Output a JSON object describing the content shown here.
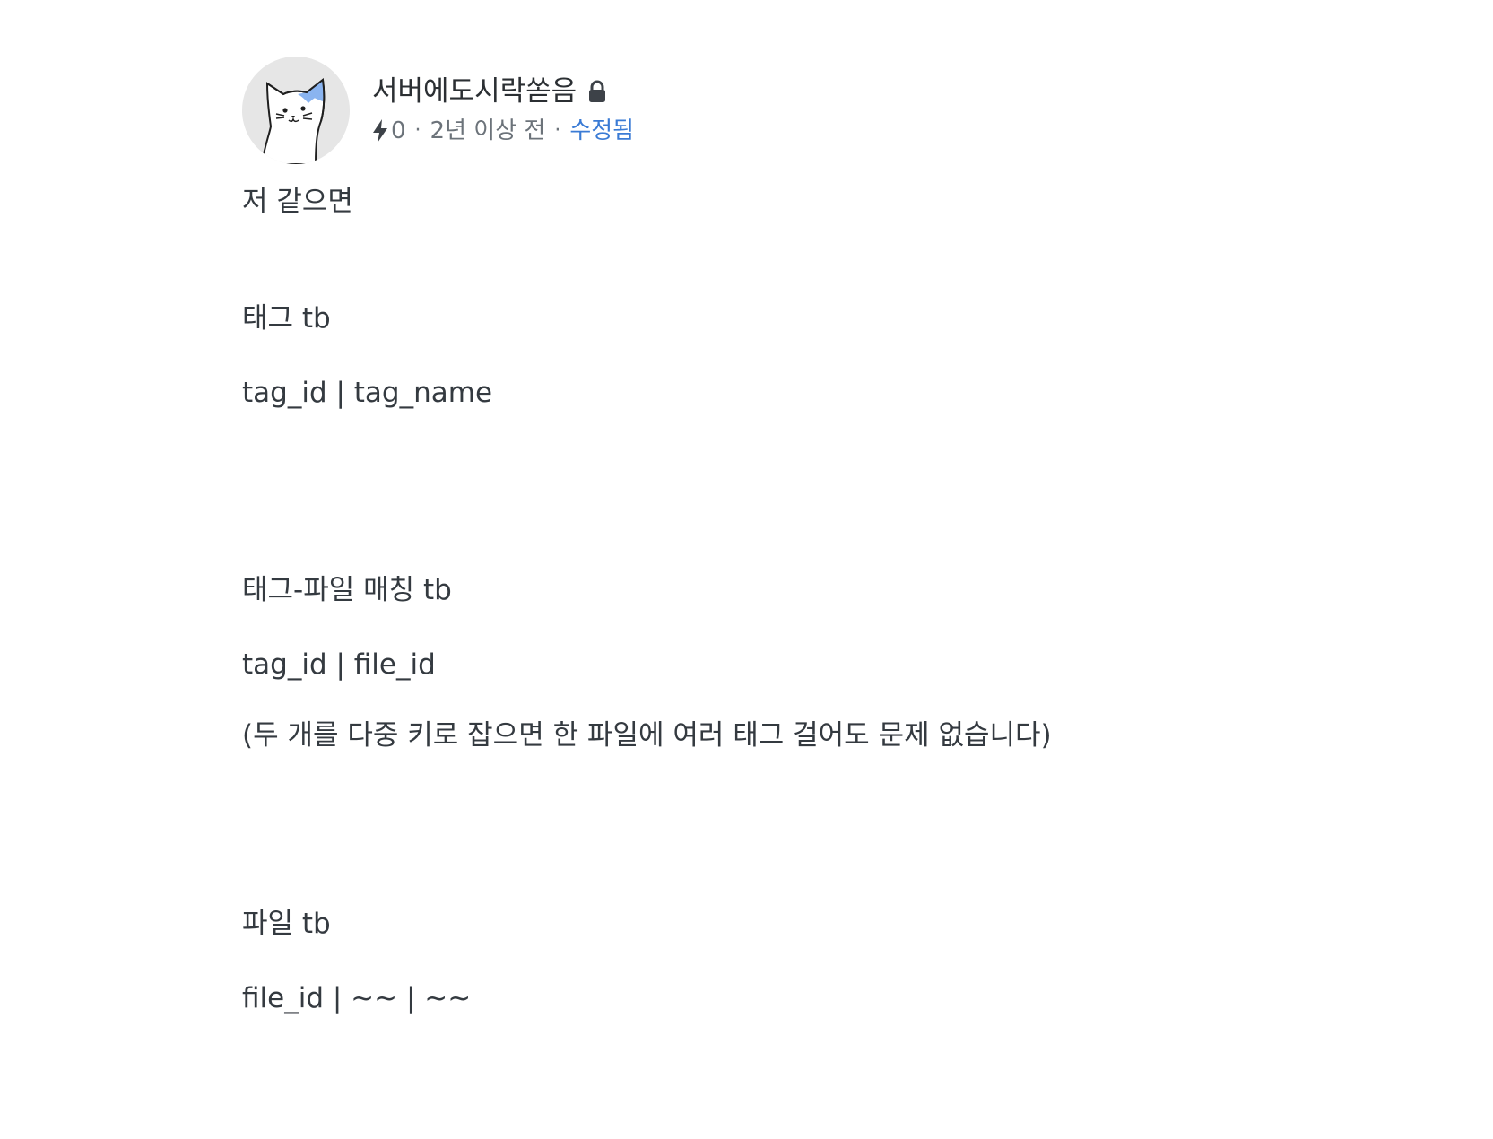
{
  "author": {
    "name": "서버에도시락쏟음",
    "avatar_icon": "cat-avatar-icon",
    "lock_icon": "lock-icon"
  },
  "meta": {
    "vote_icon": "bolt-icon",
    "votes": "0",
    "time": "2년 이상 전",
    "edited": "수정됨",
    "edited_color": "#3a7bd5"
  },
  "content": {
    "lines": [
      "저 같으면",
      "태그 tb",
      "tag_id | tag_name",
      "태그-파일 매칭 tb",
      "tag_id | file_id",
      "(두 개를 다중 키로 잡으면 한 파일에 여러 태그 걸어도 문제 없습니다)",
      "파일 tb",
      "file_id | ~~ | ~~"
    ]
  }
}
